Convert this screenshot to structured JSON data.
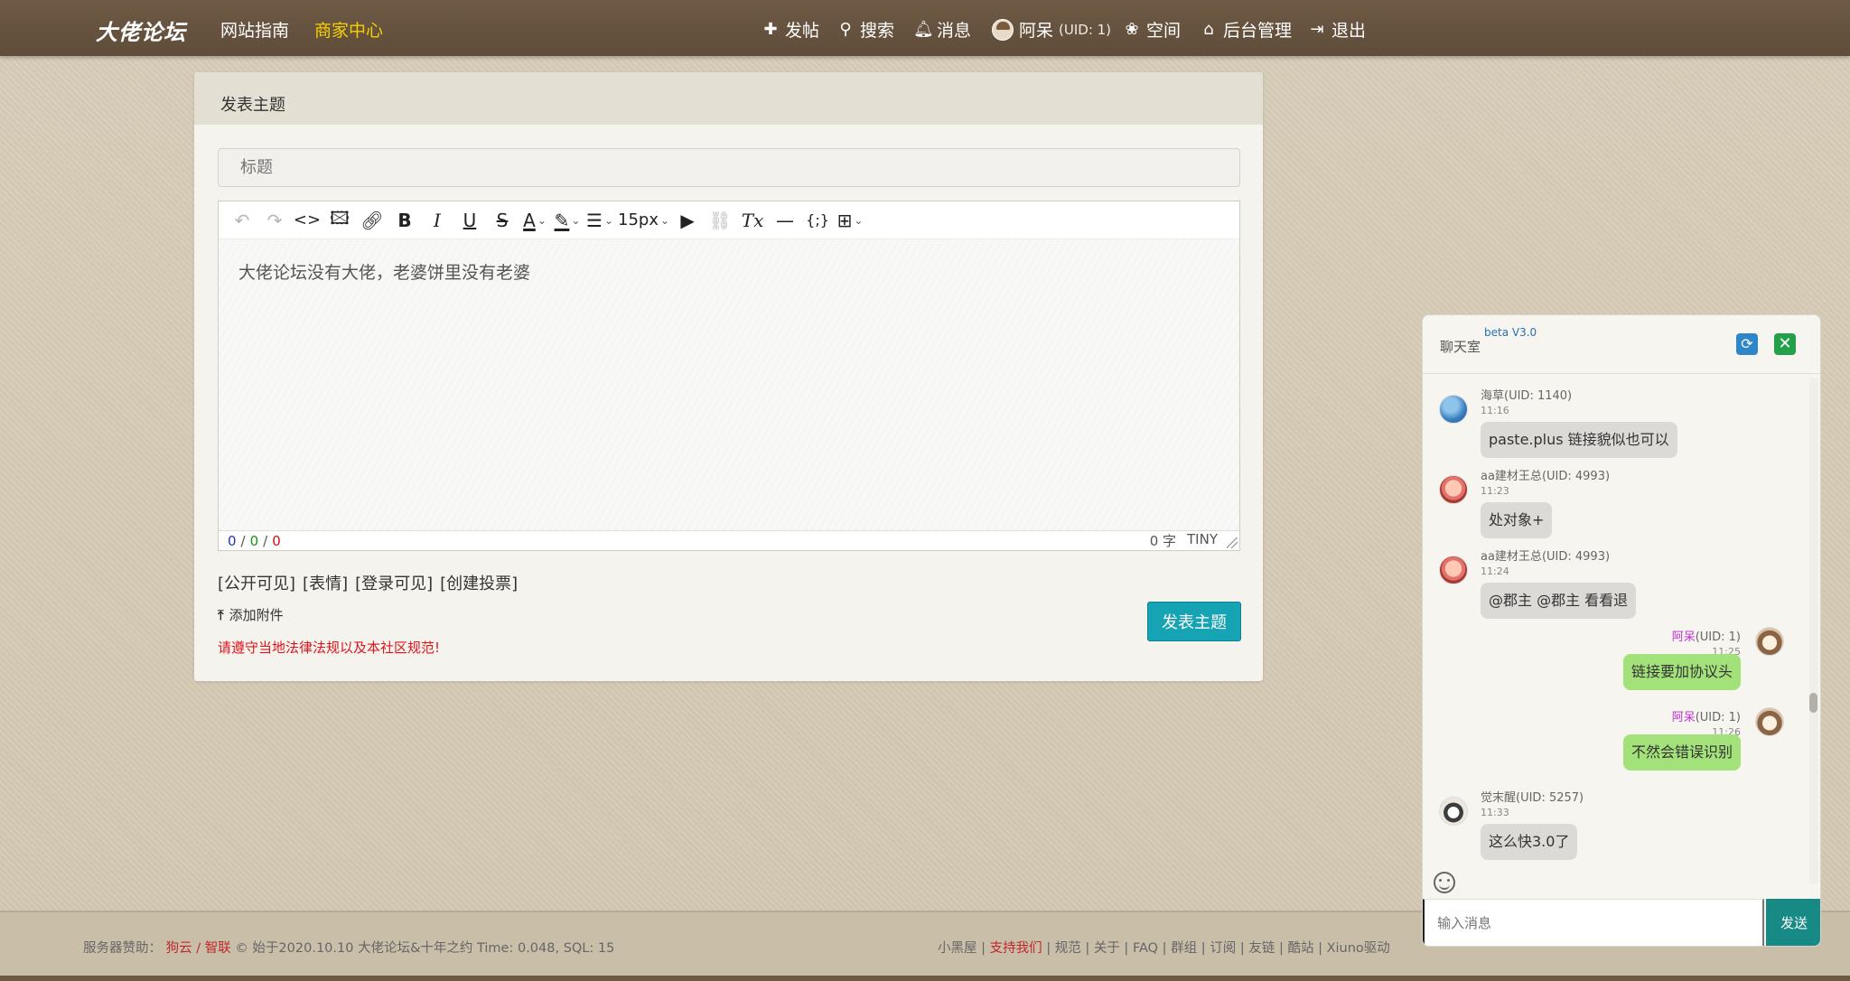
{
  "nav": {
    "logo": "大佬论坛",
    "guide": "网站指南",
    "merchant": "商家中心",
    "post": "发帖",
    "search": "搜索",
    "messages": "消息",
    "user_name": "阿呆",
    "user_uid": "(UID: 1)",
    "space": "空间",
    "admin": "后台管理",
    "logout": "退出"
  },
  "editor_card": {
    "header": "发表主题",
    "title_placeholder": "标题",
    "content": "大佬论坛没有大佬，老婆饼里没有老婆",
    "font_size": "15px",
    "status_a": "0",
    "status_b": "0",
    "status_c": "0",
    "status_sep": "/",
    "word_count": "0 字",
    "engine": "TINY",
    "options": [
      "[公开可见]",
      "[表情]",
      "[登录可见]",
      "[创建投票]"
    ],
    "attach_label": "添加附件",
    "notice": "请遵守当地法律法规以及本社区规范!",
    "submit_label": "发表主题"
  },
  "chat": {
    "title": "聊天室",
    "version": "beta V3.0",
    "messages": [
      {
        "name": "海草",
        "uid": "(UID: 1140)",
        "time": "11:16",
        "text": "paste.plus 链接貌似也可以",
        "self": false,
        "avatar": "blue"
      },
      {
        "name": "aa建材王总",
        "uid": "(UID: 4993)",
        "time": "11:23",
        "text": "处对象+",
        "self": false,
        "avatar": "red"
      },
      {
        "name": "aa建材王总",
        "uid": "(UID: 4993)",
        "time": "11:24",
        "text": "@郡主 @郡主 看看退",
        "self": false,
        "avatar": "red"
      },
      {
        "name": "阿呆",
        "uid": "(UID: 1)",
        "time": "11:25",
        "text": "链接要加协议头",
        "self": true,
        "avatar": "cream"
      },
      {
        "name": "阿呆",
        "uid": "(UID: 1)",
        "time": "11:26",
        "text": "不然会错误识别",
        "self": true,
        "avatar": "cream"
      },
      {
        "name": "觉末醒",
        "uid": "(UID: 5257)",
        "time": "11:33",
        "text": "这么快3.0了",
        "self": false,
        "avatar": "pale"
      }
    ],
    "input_placeholder": "输入消息",
    "send_label": "发送"
  },
  "footer": {
    "sponsor_label": "服务器赞助：",
    "sponsor_1": "狗云",
    "sponsor_sep": " / ",
    "sponsor_2": "智联",
    "copyright": "© 始于2020.10.10 大佬论坛&十年之约 Time: 0.048, SQL: 15",
    "links": [
      {
        "text": "小黑屋",
        "highlight": false
      },
      {
        "text": "支持我们",
        "highlight": true
      },
      {
        "text": "规范",
        "highlight": false
      },
      {
        "text": "关于",
        "highlight": false
      },
      {
        "text": "FAQ",
        "highlight": false
      },
      {
        "text": "群组",
        "highlight": false
      },
      {
        "text": "订阅",
        "highlight": false
      },
      {
        "text": "友链",
        "highlight": false
      },
      {
        "text": "酷站",
        "highlight": false
      },
      {
        "text": "Xiuno驱动",
        "highlight": false
      }
    ],
    "link_sep": " | "
  },
  "colors": {
    "navbar": "#6a5642",
    "active_nav": "#f5d100",
    "submit": "#16a3b3",
    "chat_self_bubble": "#a3e27a",
    "chat_other_bubble": "#dcdad6",
    "notice": "#e1141c"
  }
}
